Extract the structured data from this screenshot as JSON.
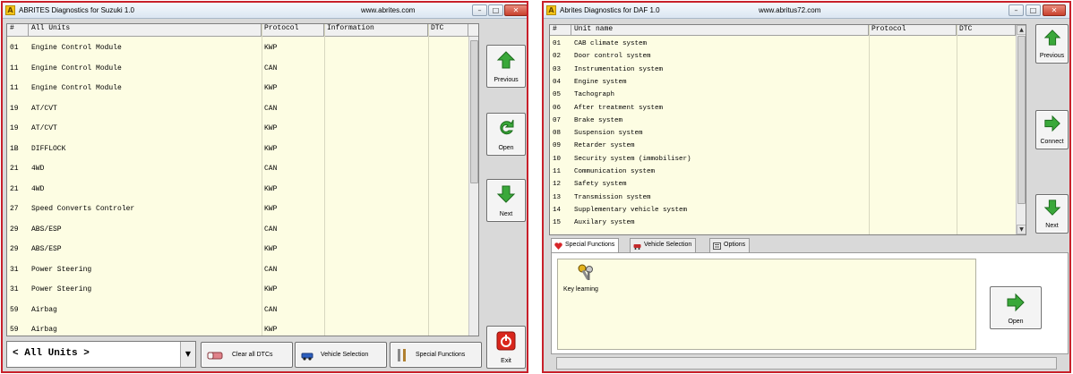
{
  "window1": {
    "title": "ABRITES Diagnostics for Suzuki 1.0",
    "url": "www.abrites.com",
    "titlebar_buttons": {
      "minimize": "–",
      "maximize": "□",
      "close": "✕"
    },
    "columns": [
      "#",
      "All Units",
      "Protocol",
      "Information",
      "DTC"
    ],
    "rows": [
      {
        "num": "01",
        "name": "Engine Control Module",
        "protocol": "KWP",
        "info": "",
        "dtc": ""
      },
      {
        "num": "11",
        "name": "Engine Control Module",
        "protocol": "CAN",
        "info": "",
        "dtc": ""
      },
      {
        "num": "11",
        "name": "Engine Control Module",
        "protocol": "KWP",
        "info": "",
        "dtc": ""
      },
      {
        "num": "19",
        "name": "AT/CVT",
        "protocol": "CAN",
        "info": "",
        "dtc": ""
      },
      {
        "num": "19",
        "name": "AT/CVT",
        "protocol": "KWP",
        "info": "",
        "dtc": ""
      },
      {
        "num": "1B",
        "name": "DIFFLOCK",
        "protocol": "KWP",
        "info": "",
        "dtc": ""
      },
      {
        "num": "21",
        "name": "4WD",
        "protocol": "CAN",
        "info": "",
        "dtc": ""
      },
      {
        "num": "21",
        "name": "4WD",
        "protocol": "KWP",
        "info": "",
        "dtc": ""
      },
      {
        "num": "27",
        "name": "Speed Converts Controler",
        "protocol": "KWP",
        "info": "",
        "dtc": ""
      },
      {
        "num": "29",
        "name": "ABS/ESP",
        "protocol": "CAN",
        "info": "",
        "dtc": ""
      },
      {
        "num": "29",
        "name": "ABS/ESP",
        "protocol": "KWP",
        "info": "",
        "dtc": ""
      },
      {
        "num": "31",
        "name": "Power Steering",
        "protocol": "CAN",
        "info": "",
        "dtc": ""
      },
      {
        "num": "31",
        "name": "Power Steering",
        "protocol": "KWP",
        "info": "",
        "dtc": ""
      },
      {
        "num": "59",
        "name": "Airbag",
        "protocol": "CAN",
        "info": "",
        "dtc": ""
      },
      {
        "num": "59",
        "name": "Airbag",
        "protocol": "KWP",
        "info": "",
        "dtc": ""
      }
    ],
    "side_buttons": {
      "previous": "Previous",
      "open": "Open",
      "next": "Next",
      "exit": "Exit"
    },
    "filter_value": "< All Units >",
    "bottom_buttons": {
      "clear_dtcs": "Clear all DTCs",
      "vehicle_selection": "Vehicle Selection",
      "special_functions": "Special Functions"
    },
    "icons": {
      "previous": "arrow-up-icon",
      "open": "refresh-arrow-icon",
      "next": "arrow-down-icon",
      "exit": "power-icon"
    },
    "colors": {
      "frame": "#c8202a",
      "list_bg": "#fdfde3",
      "arrow_green": "#3aa83a"
    }
  },
  "window2": {
    "title": "Abrites Diagnostics for DAF 1.0",
    "url": "www.abritus72.com",
    "titlebar_buttons": {
      "minimize": "–",
      "maximize": "□",
      "close": "✕"
    },
    "columns": [
      "#",
      "Unit name",
      "Protocol",
      "DTC"
    ],
    "rows": [
      {
        "num": "01",
        "name": "CAB climate system",
        "protocol": "",
        "dtc": ""
      },
      {
        "num": "02",
        "name": "Door control system",
        "protocol": "",
        "dtc": ""
      },
      {
        "num": "03",
        "name": "Instrumentation system",
        "protocol": "",
        "dtc": ""
      },
      {
        "num": "04",
        "name": "Engine system",
        "protocol": "",
        "dtc": ""
      },
      {
        "num": "05",
        "name": "Tachograph",
        "protocol": "",
        "dtc": ""
      },
      {
        "num": "06",
        "name": "After treatment system",
        "protocol": "",
        "dtc": ""
      },
      {
        "num": "07",
        "name": "Brake system",
        "protocol": "",
        "dtc": ""
      },
      {
        "num": "08",
        "name": "Suspension system",
        "protocol": "",
        "dtc": ""
      },
      {
        "num": "09",
        "name": "Retarder system",
        "protocol": "",
        "dtc": ""
      },
      {
        "num": "10",
        "name": "Security system (immobiliser)",
        "protocol": "",
        "dtc": ""
      },
      {
        "num": "11",
        "name": "Communication system",
        "protocol": "",
        "dtc": ""
      },
      {
        "num": "12",
        "name": "Safety system",
        "protocol": "",
        "dtc": ""
      },
      {
        "num": "13",
        "name": "Transmission system",
        "protocol": "",
        "dtc": ""
      },
      {
        "num": "14",
        "name": "Supplementary vehicle system",
        "protocol": "",
        "dtc": ""
      },
      {
        "num": "15",
        "name": "Auxilary system",
        "protocol": "",
        "dtc": ""
      }
    ],
    "side_buttons": {
      "previous": "Previous",
      "connect": "Connect",
      "next": "Next"
    },
    "tabs": [
      "Special Functions",
      "Vehicle Selection",
      "Options"
    ],
    "panel_item": "Key learning",
    "open_button": "Open",
    "icons": {
      "previous": "arrow-up-icon",
      "connect": "arrow-right-icon",
      "next": "arrow-down-icon",
      "key_learning": "keys-icon"
    }
  }
}
